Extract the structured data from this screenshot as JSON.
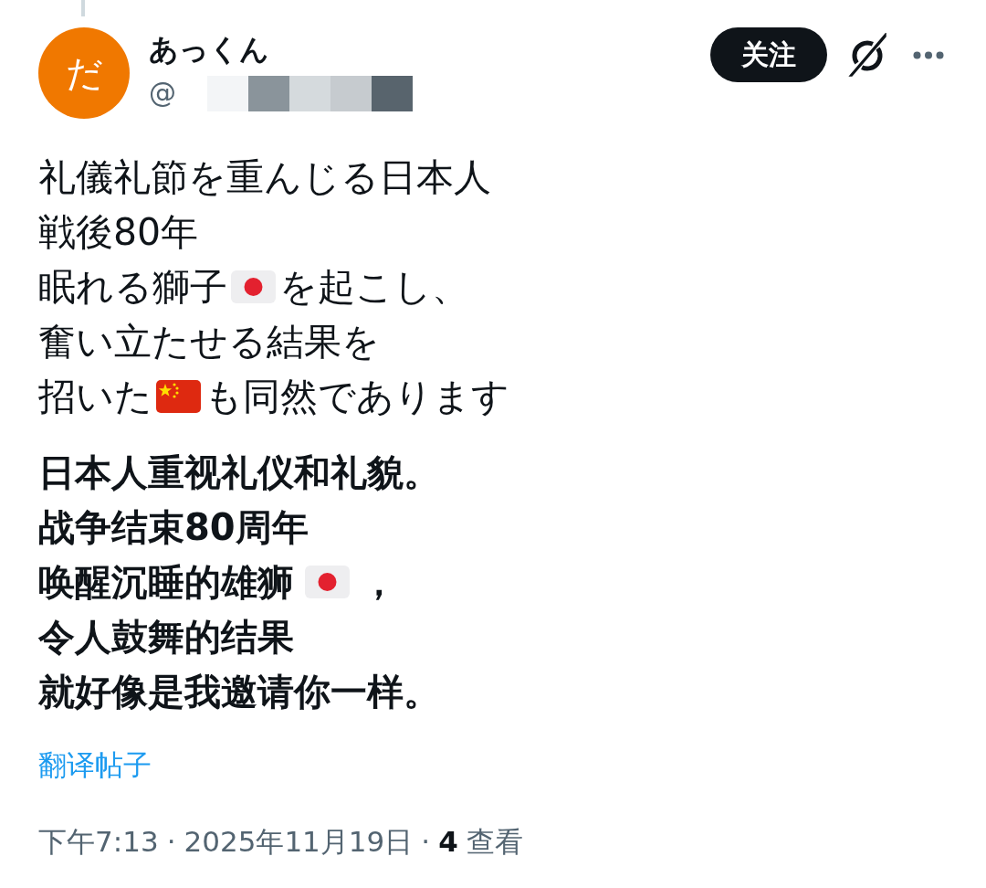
{
  "author": {
    "avatar_text": "だ",
    "name": "あっくん",
    "handle_prefix": "@"
  },
  "actions": {
    "follow_label": "关注"
  },
  "post": {
    "original_lines": [
      [
        {
          "kind": "text",
          "text": "礼儀礼節を重んじる日本人"
        }
      ],
      [
        {
          "kind": "text",
          "text": "戦後80年"
        }
      ],
      [
        {
          "kind": "text",
          "text": "眠れる獅子"
        },
        {
          "kind": "flagjp"
        },
        {
          "kind": "text",
          "text": "を起こし、"
        }
      ],
      [
        {
          "kind": "text",
          "text": "奮い立たせる結果を"
        }
      ],
      [
        {
          "kind": "text",
          "text": "招いた"
        },
        {
          "kind": "flagcn"
        },
        {
          "kind": "text",
          "text": "も同然であります"
        }
      ]
    ],
    "translation_lines": [
      [
        {
          "kind": "text",
          "text": "日本人重视礼仪和礼貌。"
        }
      ],
      [
        {
          "kind": "text",
          "text": "战争结束80周年"
        }
      ],
      [
        {
          "kind": "text",
          "text": "唤醒沉睡的雄狮"
        },
        {
          "kind": "flagjp"
        },
        {
          "kind": "text",
          "text": "，"
        }
      ],
      [
        {
          "kind": "text",
          "text": "令人鼓舞的结果"
        }
      ],
      [
        {
          "kind": "text",
          "text": "就好像是我邀请你一样。"
        }
      ]
    ],
    "translate_link": "翻译帖子"
  },
  "meta": {
    "time": "下午7:13",
    "separator_1": "·",
    "date": "2025年11月19日",
    "separator_2": "·",
    "views": "4",
    "views_label": "查看"
  }
}
